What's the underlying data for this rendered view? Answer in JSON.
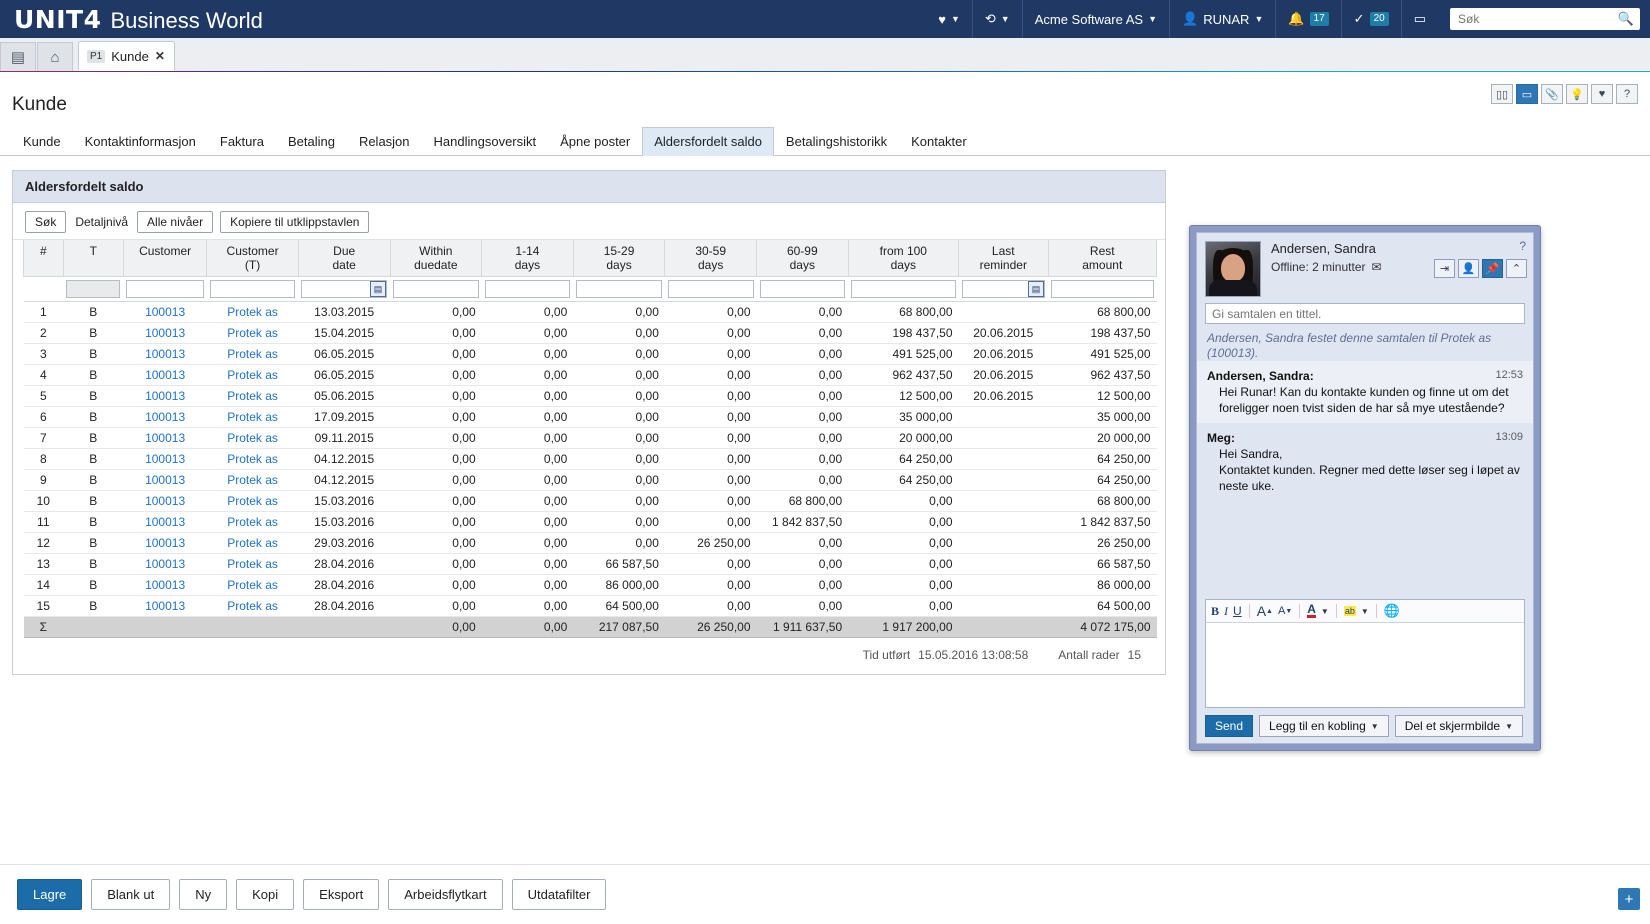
{
  "app": {
    "brand_mark": "UNIT4",
    "brand_name": "Business World"
  },
  "topbar": {
    "favorites_icon": "heart-icon",
    "history_icon": "history-icon",
    "company": "Acme Software AS",
    "user": "RUNAR",
    "user_icon": "person-icon",
    "bell_icon": "bell-icon",
    "bell_count": "17",
    "check_icon": "check-icon",
    "check_count": "20",
    "chat_icon": "speech-bubble-icon",
    "search_placeholder": "Søk",
    "search_value": ""
  },
  "tabstrip": {
    "menu_icon": "list-menu-icon",
    "home_icon": "home-icon",
    "doc_badge": "P1",
    "doc_label": "Kunde",
    "doc_close": "✕"
  },
  "window_icons": [
    {
      "name": "split-view-icon",
      "glyph": "▯▯"
    },
    {
      "name": "screen-icon",
      "glyph": "▭"
    },
    {
      "name": "attachment-icon",
      "glyph": "📎"
    },
    {
      "name": "lightbulb-icon",
      "glyph": "💡"
    },
    {
      "name": "heart-icon",
      "glyph": "♥"
    },
    {
      "name": "help-icon",
      "glyph": "?"
    }
  ],
  "page": {
    "title": "Kunde",
    "tabs": [
      {
        "label": "Kunde",
        "active": false
      },
      {
        "label": "Kontaktinformasjon",
        "active": false
      },
      {
        "label": "Faktura",
        "active": false
      },
      {
        "label": "Betaling",
        "active": false
      },
      {
        "label": "Relasjon",
        "active": false
      },
      {
        "label": "Handlingsoversikt",
        "active": false
      },
      {
        "label": "Åpne poster",
        "active": false
      },
      {
        "label": "Aldersfordelt saldo",
        "active": true
      },
      {
        "label": "Betalingshistorikk",
        "active": false
      },
      {
        "label": "Kontakter",
        "active": false
      }
    ]
  },
  "card": {
    "title": "Aldersfordelt saldo",
    "toolbar": {
      "search_button": "Søk",
      "detail_label": "Detaljnivå",
      "level_button": "Alle nivåer",
      "copy_button": "Kopiere til utklippstavlen"
    }
  },
  "table": {
    "columns": [
      {
        "l1": "#",
        "l2": "",
        "align": "ctr"
      },
      {
        "l1": "T",
        "l2": "",
        "align": "ctr"
      },
      {
        "l1": "Customer",
        "l2": "",
        "align": "ctr"
      },
      {
        "l1": "Customer",
        "l2": "(T)",
        "align": "ctr"
      },
      {
        "l1": "Due",
        "l2": "date",
        "align": "ctr"
      },
      {
        "l1": "Within",
        "l2": "duedate",
        "align": "ctr"
      },
      {
        "l1": "1-14",
        "l2": "days",
        "align": "ctr"
      },
      {
        "l1": "15-29",
        "l2": "days",
        "align": "ctr"
      },
      {
        "l1": "30-59",
        "l2": "days",
        "align": "ctr"
      },
      {
        "l1": "60-99",
        "l2": "days",
        "align": "ctr"
      },
      {
        "l1": "from 100",
        "l2": "days",
        "align": "ctr"
      },
      {
        "l1": "Last",
        "l2": "reminder",
        "align": "ctr"
      },
      {
        "l1": "Rest",
        "l2": "amount",
        "align": "ctr"
      }
    ],
    "filter_row": {
      "due_date_calendar_icon": "calendar-icon",
      "last_reminder_calendar_icon": "calendar-icon"
    },
    "rows": [
      {
        "n": "1",
        "t": "B",
        "cust": "100013",
        "custt": "Protek as",
        "due": "13.03.2015",
        "within": "0,00",
        "d1_14": "0,00",
        "d15_29": "0,00",
        "d30_59": "0,00",
        "d60_99": "0,00",
        "d100": "68 800,00",
        "rem": "",
        "rest": "68 800,00"
      },
      {
        "n": "2",
        "t": "B",
        "cust": "100013",
        "custt": "Protek as",
        "due": "15.04.2015",
        "within": "0,00",
        "d1_14": "0,00",
        "d15_29": "0,00",
        "d30_59": "0,00",
        "d60_99": "0,00",
        "d100": "198 437,50",
        "rem": "20.06.2015",
        "rest": "198 437,50"
      },
      {
        "n": "3",
        "t": "B",
        "cust": "100013",
        "custt": "Protek as",
        "due": "06.05.2015",
        "within": "0,00",
        "d1_14": "0,00",
        "d15_29": "0,00",
        "d30_59": "0,00",
        "d60_99": "0,00",
        "d100": "491 525,00",
        "rem": "20.06.2015",
        "rest": "491 525,00"
      },
      {
        "n": "4",
        "t": "B",
        "cust": "100013",
        "custt": "Protek as",
        "due": "06.05.2015",
        "within": "0,00",
        "d1_14": "0,00",
        "d15_29": "0,00",
        "d30_59": "0,00",
        "d60_99": "0,00",
        "d100": "962 437,50",
        "rem": "20.06.2015",
        "rest": "962 437,50"
      },
      {
        "n": "5",
        "t": "B",
        "cust": "100013",
        "custt": "Protek as",
        "due": "05.06.2015",
        "within": "0,00",
        "d1_14": "0,00",
        "d15_29": "0,00",
        "d30_59": "0,00",
        "d60_99": "0,00",
        "d100": "12 500,00",
        "rem": "20.06.2015",
        "rest": "12 500,00"
      },
      {
        "n": "6",
        "t": "B",
        "cust": "100013",
        "custt": "Protek as",
        "due": "17.09.2015",
        "within": "0,00",
        "d1_14": "0,00",
        "d15_29": "0,00",
        "d30_59": "0,00",
        "d60_99": "0,00",
        "d100": "35 000,00",
        "rem": "",
        "rest": "35 000,00"
      },
      {
        "n": "7",
        "t": "B",
        "cust": "100013",
        "custt": "Protek as",
        "due": "09.11.2015",
        "within": "0,00",
        "d1_14": "0,00",
        "d15_29": "0,00",
        "d30_59": "0,00",
        "d60_99": "0,00",
        "d100": "20 000,00",
        "rem": "",
        "rest": "20 000,00"
      },
      {
        "n": "8",
        "t": "B",
        "cust": "100013",
        "custt": "Protek as",
        "due": "04.12.2015",
        "within": "0,00",
        "d1_14": "0,00",
        "d15_29": "0,00",
        "d30_59": "0,00",
        "d60_99": "0,00",
        "d100": "64 250,00",
        "rem": "",
        "rest": "64 250,00"
      },
      {
        "n": "9",
        "t": "B",
        "cust": "100013",
        "custt": "Protek as",
        "due": "04.12.2015",
        "within": "0,00",
        "d1_14": "0,00",
        "d15_29": "0,00",
        "d30_59": "0,00",
        "d60_99": "0,00",
        "d100": "64 250,00",
        "rem": "",
        "rest": "64 250,00"
      },
      {
        "n": "10",
        "t": "B",
        "cust": "100013",
        "custt": "Protek as",
        "due": "15.03.2016",
        "within": "0,00",
        "d1_14": "0,00",
        "d15_29": "0,00",
        "d30_59": "0,00",
        "d60_99": "68 800,00",
        "d100": "0,00",
        "rem": "",
        "rest": "68 800,00"
      },
      {
        "n": "11",
        "t": "B",
        "cust": "100013",
        "custt": "Protek as",
        "due": "15.03.2016",
        "within": "0,00",
        "d1_14": "0,00",
        "d15_29": "0,00",
        "d30_59": "0,00",
        "d60_99": "1 842 837,50",
        "d100": "0,00",
        "rem": "",
        "rest": "1 842 837,50"
      },
      {
        "n": "12",
        "t": "B",
        "cust": "100013",
        "custt": "Protek as",
        "due": "29.03.2016",
        "within": "0,00",
        "d1_14": "0,00",
        "d15_29": "0,00",
        "d30_59": "26 250,00",
        "d60_99": "0,00",
        "d100": "0,00",
        "rem": "",
        "rest": "26 250,00"
      },
      {
        "n": "13",
        "t": "B",
        "cust": "100013",
        "custt": "Protek as",
        "due": "28.04.2016",
        "within": "0,00",
        "d1_14": "0,00",
        "d15_29": "66 587,50",
        "d30_59": "0,00",
        "d60_99": "0,00",
        "d100": "0,00",
        "rem": "",
        "rest": "66 587,50"
      },
      {
        "n": "14",
        "t": "B",
        "cust": "100013",
        "custt": "Protek as",
        "due": "28.04.2016",
        "within": "0,00",
        "d1_14": "0,00",
        "d15_29": "86 000,00",
        "d30_59": "0,00",
        "d60_99": "0,00",
        "d100": "0,00",
        "rem": "",
        "rest": "86 000,00"
      },
      {
        "n": "15",
        "t": "B",
        "cust": "100013",
        "custt": "Protek as",
        "due": "28.04.2016",
        "within": "0,00",
        "d1_14": "0,00",
        "d15_29": "64 500,00",
        "d30_59": "0,00",
        "d60_99": "0,00",
        "d100": "0,00",
        "rem": "",
        "rest": "64 500,00"
      }
    ],
    "sum_row": {
      "symbol": "Σ",
      "within": "0,00",
      "d1_14": "0,00",
      "d15_29": "217 087,50",
      "d30_59": "26 250,00",
      "d60_99": "1 911 637,50",
      "d100": "1 917 200,00",
      "rest": "4 072 175,00"
    },
    "footer": {
      "time_label": "Tid utført",
      "time_value": "15.05.2016 13:08:58",
      "rows_label": "Antall rader",
      "rows_value": "15"
    }
  },
  "actions": [
    {
      "label": "Lagre",
      "primary": true
    },
    {
      "label": "Blank ut",
      "primary": false
    },
    {
      "label": "Ny",
      "primary": false
    },
    {
      "label": "Kopi",
      "primary": false
    },
    {
      "label": "Eksport",
      "primary": false
    },
    {
      "label": "Arbeidsflytkart",
      "primary": false
    },
    {
      "label": "Utdatafilter",
      "primary": false
    }
  ],
  "add_button": "+",
  "chat": {
    "close_icon": "close-icon",
    "help_icon": "help-icon",
    "contact_name": "Andersen, Sandra",
    "status": "Offline: 2 minutter",
    "status_mail_icon": "mail-icon",
    "actions": [
      {
        "name": "leave-conversation-icon",
        "glyph": "⇥",
        "on": false
      },
      {
        "name": "add-person-icon",
        "glyph": "👤",
        "on": false
      },
      {
        "name": "pin-icon",
        "glyph": "📌",
        "on": true
      },
      {
        "name": "collapse-icon",
        "glyph": "⌃",
        "on": false
      }
    ],
    "title_placeholder": "Gi samtalen en tittel.",
    "title_value": "",
    "pin_note": "Andersen, Sandra festet denne samtalen til Protek as (100013).",
    "messages": [
      {
        "who": "Andersen, Sandra:",
        "time": "12:53",
        "body": "Hei Runar! Kan du kontakte kunden og finne ut om det foreligger noen tvist siden de har så mye utestående?"
      },
      {
        "who": "Meg:",
        "time": "13:09",
        "body": "Hei Sandra,\nKontaktet kunden. Regner med dette løser seg i løpet av neste uke."
      }
    ],
    "editor_toolbar": [
      {
        "name": "bold-icon",
        "glyph": "B"
      },
      {
        "name": "italic-icon",
        "glyph": "I"
      },
      {
        "name": "underline-icon",
        "glyph": "U"
      },
      {
        "name": "increase-font-icon",
        "glyph": "A"
      },
      {
        "name": "decrease-font-icon",
        "glyph": "A"
      },
      {
        "name": "font-color-icon",
        "glyph": "A"
      },
      {
        "name": "highlight-icon",
        "glyph": "ab"
      },
      {
        "name": "insert-link-icon",
        "glyph": "🌐"
      }
    ],
    "compose_value": "",
    "buttons": {
      "send": "Send",
      "link": "Legg til en kobling",
      "screenshot": "Del et skjermbilde"
    }
  }
}
